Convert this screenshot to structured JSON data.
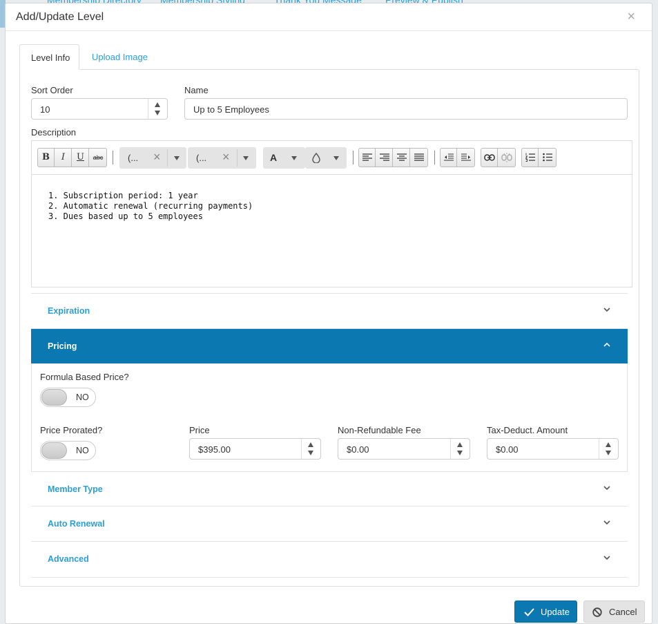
{
  "background": {
    "nav_items": [
      "Membership Directory",
      "Membership Styling",
      "Thank You Message",
      "Preview & Publish"
    ]
  },
  "dialog": {
    "title": "Add/Update Level",
    "close_glyph": "×"
  },
  "tabs": [
    {
      "label": "Level Info",
      "active": true
    },
    {
      "label": "Upload Image",
      "active": false
    }
  ],
  "form": {
    "sort_order": {
      "label": "Sort Order",
      "value": "10"
    },
    "name": {
      "label": "Name",
      "value": "Up to 5 Employees"
    },
    "description": {
      "label": "Description",
      "toolbar": {
        "bold": "B",
        "italic": "I",
        "underline": "U",
        "strike": "abc",
        "font_family": "(...",
        "font_size": "(...",
        "font_color": "A",
        "clear_glyph": "×"
      },
      "lines": [
        "1. Subscription period: 1 year",
        "2. Automatic renewal (recurring payments)",
        "3. Dues based up to 5 employees"
      ]
    }
  },
  "accordion": {
    "expiration": {
      "title": "Expiration"
    },
    "pricing": {
      "title": "Pricing",
      "formula_label": "Formula Based Price?",
      "formula_value": "NO",
      "prorated_label": "Price Prorated?",
      "prorated_value": "NO",
      "price_label": "Price",
      "price_value": "$395.00",
      "fee_label": "Non-Refundable Fee",
      "fee_value": "$0.00",
      "tax_label": "Tax-Deduct. Amount",
      "tax_value": "$0.00"
    },
    "member_type": {
      "title": "Member Type"
    },
    "auto_renewal": {
      "title": "Auto Renewal"
    },
    "advanced": {
      "title": "Advanced"
    }
  },
  "footer": {
    "update_label": "Update",
    "cancel_label": "Cancel"
  },
  "colors": {
    "accent": "#2a9fd6",
    "active_header": "#0b78b2"
  }
}
